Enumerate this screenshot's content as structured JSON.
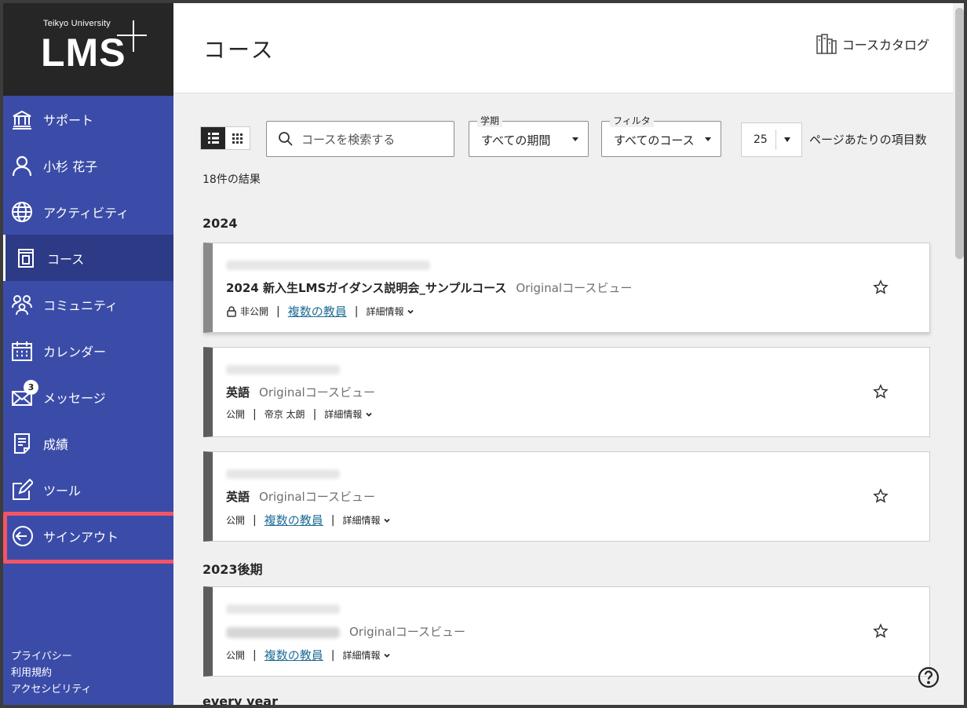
{
  "logo": {
    "university": "Teikyo University",
    "product": "LMS"
  },
  "sidebar": {
    "items": [
      {
        "label": "サポート",
        "icon": "institution-icon"
      },
      {
        "label": "小杉 花子",
        "icon": "user-icon"
      },
      {
        "label": "アクティビティ",
        "icon": "globe-icon"
      },
      {
        "label": "コース",
        "icon": "course-icon",
        "active": true
      },
      {
        "label": "コミュニティ",
        "icon": "community-icon"
      },
      {
        "label": "カレンダー",
        "icon": "calendar-icon"
      },
      {
        "label": "メッセージ",
        "icon": "mail-icon",
        "badge": "3"
      },
      {
        "label": "成績",
        "icon": "grades-icon"
      },
      {
        "label": "ツール",
        "icon": "tools-icon"
      },
      {
        "label": "サインアウト",
        "icon": "signout-icon"
      }
    ],
    "footer": [
      "プライバシー",
      "利用規約",
      "アクセシビリティ"
    ],
    "highlight_color": "#f25566"
  },
  "header": {
    "title": "コース",
    "catalog_label": "コースカタログ"
  },
  "toolbar": {
    "search_placeholder": "コースを検索する",
    "term": {
      "label": "学期",
      "value": "すべての期間"
    },
    "filter": {
      "label": "フィルタ",
      "value": "すべてのコース"
    },
    "per_page_value": "25",
    "per_page_label": "ページあたりの項目数"
  },
  "results": "18件の結果",
  "groups": [
    {
      "title": "2024"
    },
    {
      "title": "2023後期"
    },
    {
      "title": "every year"
    }
  ],
  "courses": [
    {
      "title": "2024 新入生LMSガイダンス説明会_サンプルコース",
      "view": "Originalコースビュー",
      "status": "非公開",
      "instructor": "複数の教員",
      "details": "詳細情報"
    },
    {
      "title": "英語",
      "view": "Originalコースビュー",
      "status": "公開",
      "instructor": "帝京 太朗",
      "details": "詳細情報"
    },
    {
      "title": "英語",
      "view": "Originalコースビュー",
      "status": "公開",
      "instructor": "複数の教員",
      "details": "詳細情報"
    },
    {
      "title": "",
      "view": "Originalコースビュー",
      "status": "公開",
      "instructor": "複数の教員",
      "details": "詳細情報"
    }
  ],
  "colors": {
    "sidebar": "#3b4ca8",
    "sidebar_active": "#2d3a85",
    "logo_bg": "#262626",
    "link": "#1f6e96"
  }
}
